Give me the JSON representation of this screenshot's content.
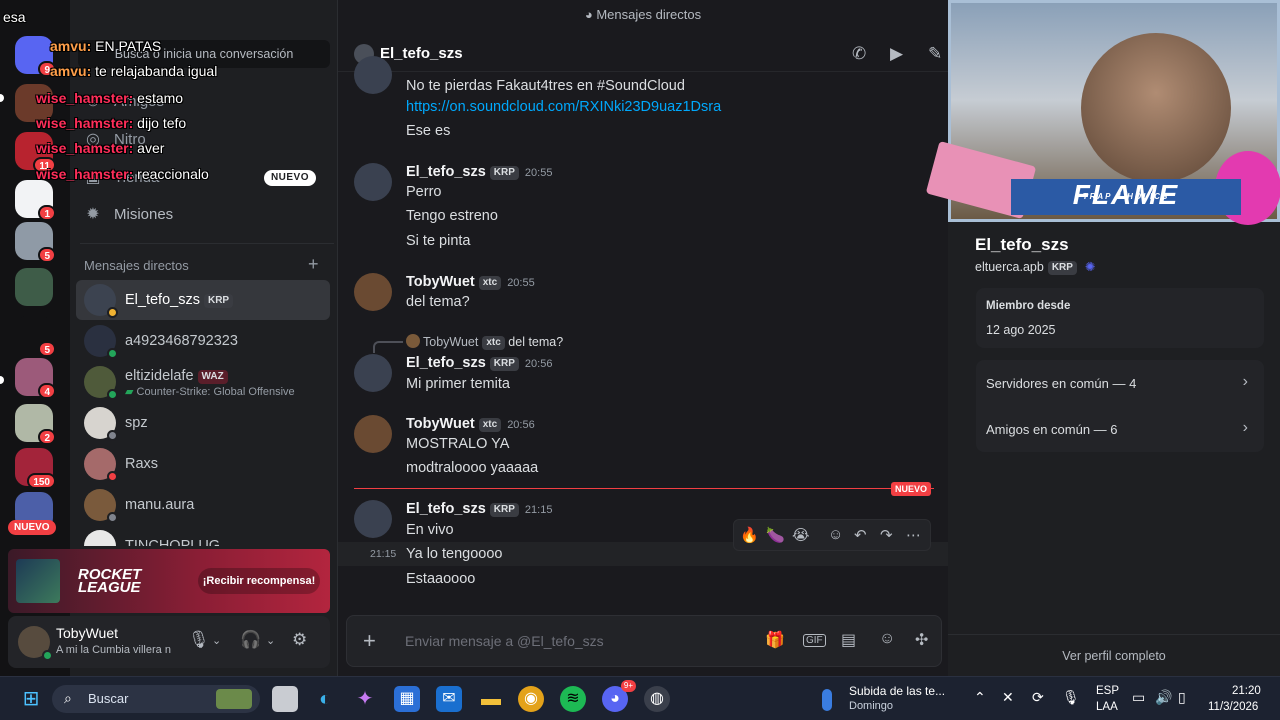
{
  "window": {
    "top_title": "Mensajes directos"
  },
  "sidebar": {
    "search_placeholder": "Busca o inicia una conversación",
    "nav": [
      {
        "label": "Amigos"
      },
      {
        "label": "Nitro"
      },
      {
        "label": "Tienda",
        "badge": "NUEVO"
      },
      {
        "label": "Misiones"
      }
    ],
    "dm_header": "Mensajes directos",
    "dms": [
      {
        "name": "El_tefo_szs",
        "tag": "KRP",
        "sub": ""
      },
      {
        "name": "a4923468792323",
        "tag": "",
        "sub": ""
      },
      {
        "name": "eltizidelafe",
        "tag": "WAZ",
        "sub": "Counter-Strike: Global Offensive"
      },
      {
        "name": "spz",
        "tag": "",
        "sub": ""
      },
      {
        "name": "Raxs",
        "tag": "",
        "sub": ""
      },
      {
        "name": "manu.aura",
        "tag": "",
        "sub": ""
      },
      {
        "name": "TINCHOPLUG",
        "tag": "",
        "sub": ""
      }
    ],
    "promo": {
      "logo_line1": "ROCKET",
      "logo_line2": "LEAGUE",
      "cta": "¡Recibir recompensa!"
    },
    "user": {
      "name": "TobyWuet",
      "status": "A mi la Cumbia villera n"
    }
  },
  "rail": {
    "badges": [
      "9",
      "11",
      "1",
      "5",
      "5",
      "4",
      "2",
      "150"
    ],
    "new_label": "NUEVO"
  },
  "chat": {
    "header_name": "El_tefo_szs",
    "messages": {
      "m0_line1": "No te pierdas Fakaut4tres en #SoundCloud",
      "m0_link": "https://on.soundcloud.com/RXINki23D9uaz1Dsra",
      "m0_line2": "Ese es",
      "m1_user": "El_tefo_szs",
      "m1_tag": "KRP",
      "m1_time": "20:55",
      "m1_l1": "Perro",
      "m1_l2": "Tengo estreno",
      "m1_l3": "Si te pinta",
      "m2_user": "TobyWuet",
      "m2_tag": "xtc",
      "m2_time": "20:55",
      "m2_l1": "del tema?",
      "reply_user": "TobyWuet",
      "reply_tag": "xtc",
      "reply_text": "del tema?",
      "m3_user": "El_tefo_szs",
      "m3_tag": "KRP",
      "m3_time": "20:56",
      "m3_l1": "Mi primer temita",
      "m4_user": "TobyWuet",
      "m4_tag": "xtc",
      "m4_time": "20:56",
      "m4_l1": "MOSTRALO YA",
      "m4_l2": "modtraloooo yaaaaa",
      "new_label": "NUEVO",
      "m5_user": "El_tefo_szs",
      "m5_tag": "KRP",
      "m5_time": "21:15",
      "m5_l1": "En vivo",
      "m5_hover_time": "21:15",
      "m5_l2": "Ya lo tengoooo",
      "m5_l3": "Estaaoooo"
    },
    "reactions": [
      "🔥",
      "🍆",
      "😭"
    ],
    "composer_placeholder": "Enviar mensaje a @El_tefo_szs"
  },
  "profile": {
    "name": "El_tefo_szs",
    "handle": "eltuerca.apb",
    "tag": "KRP",
    "member_since_label": "Miembro desde",
    "member_since": "12 ago 2025",
    "servers": "Servidores en común — 4",
    "friends": "Amigos en común — 6",
    "view_full": "Ver perfil completo",
    "webcam_banner": "FLAME",
    "webcam_banner_sub": "TRAP 4 HOLICS"
  },
  "stream_overlay": [
    {
      "user": "",
      "text": "esa"
    },
    {
      "user": "amvu:",
      "text": "EN PATAS"
    },
    {
      "user": "amvu:",
      "text": "te relajabanda igual"
    },
    {
      "user": "wise_hamster:",
      "text": "estamo"
    },
    {
      "user": "wise_hamster:",
      "text": "dijo tefo"
    },
    {
      "user": "wise_hamster:",
      "text": "aver"
    },
    {
      "user": "wise_hamster:",
      "text": "reaccionalo"
    }
  ],
  "taskbar": {
    "search": "Buscar",
    "media_title": "Subida de las te...",
    "media_sub": "Domingo",
    "lang1": "ESP",
    "lang2": "LAA",
    "time": "21:20",
    "date": "11/3/2026",
    "discord_badge": "9+"
  }
}
